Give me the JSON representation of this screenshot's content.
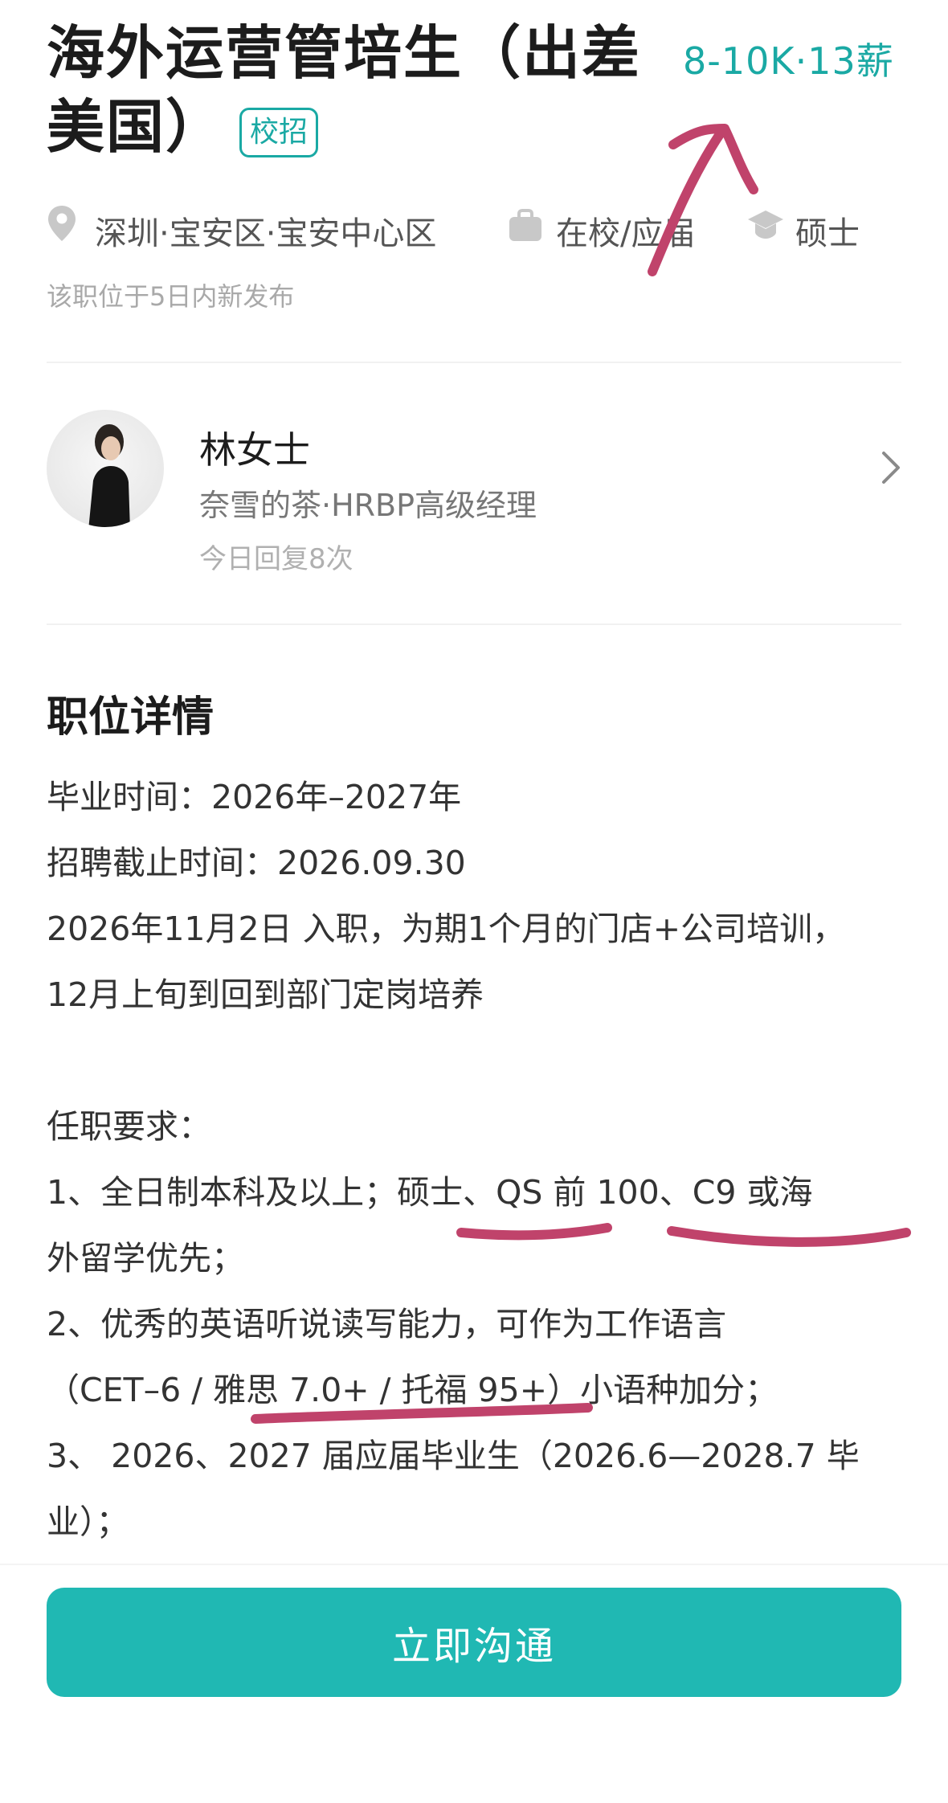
{
  "job": {
    "title_line1": "海外运营管培生（出差",
    "title_line2": "美国）",
    "badge": "校招",
    "salary": "8-10K·13薪",
    "location": "深圳·宝安区·宝安中心区",
    "experience": "在校/应届",
    "degree": "硕士",
    "posted": "该职位于5日内新发布"
  },
  "recruiter": {
    "name": "林女士",
    "company_title": "奈雪的茶·HRBP高级经理",
    "reply_stats": "今日回复8次"
  },
  "details": {
    "title": "职位详情",
    "lines": [
      "毕业时间：2026年–2027年",
      "招聘截止时间：2026.09.30",
      "2026年11月2日 入职，为期1个月的门店+公司培训，",
      "12月上旬到回到部门定岗培养",
      "",
      "任职要求：",
      "1、全日制本科及以上；硕士、QS 前 100、C9 或海",
      "外留学优先；",
      "2、优秀的英语听说读写能力，可作为工作语言",
      "（CET–6 / 雅思 7.0+ / 托福 95+）小语种加分；",
      "3、 2026、2027 届应届毕业生（2026.6—2028.7 毕",
      "业）；"
    ]
  },
  "actions": {
    "chat_button": "立即沟通"
  },
  "icons": {
    "location": "location-pin-icon",
    "experience": "briefcase-icon",
    "degree": "graduation-cap-icon",
    "chevron": "chevron-right-icon"
  },
  "colors": {
    "accent": "#1aa9a4",
    "button": "#20b8b3",
    "annotation": "#c0436b"
  }
}
